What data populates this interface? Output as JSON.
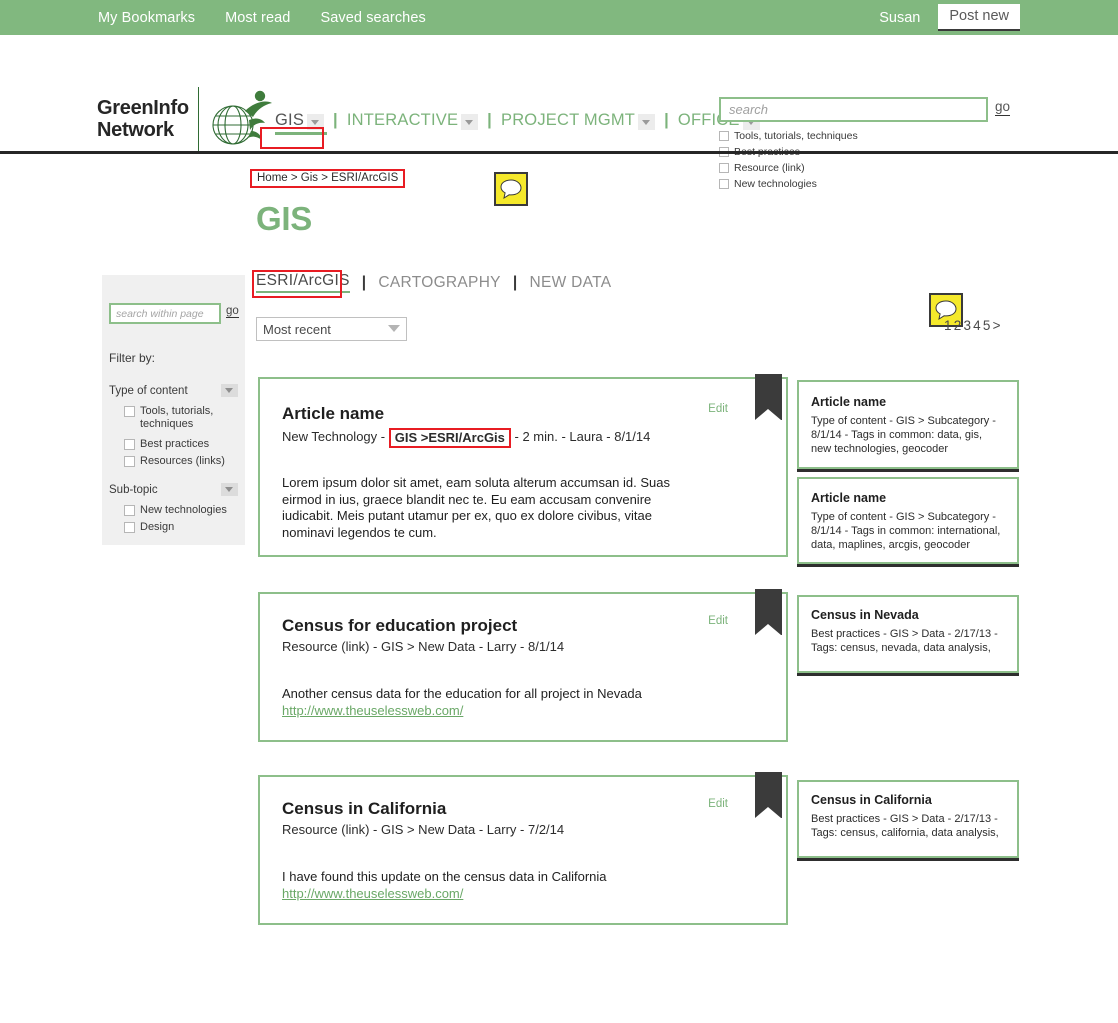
{
  "topbar": {
    "links": [
      "My Bookmarks",
      "Most read",
      "Saved searches"
    ],
    "user": "Susan",
    "post_new": "Post new",
    "bg_color": "#81b87f"
  },
  "logo": {
    "line1": "GreenInfo",
    "line2": "Network"
  },
  "nav": {
    "items": [
      {
        "label": "GIS",
        "active": true
      },
      {
        "label": "INTERACTIVE",
        "active": false
      },
      {
        "label": "PROJECT MGMT",
        "active": false
      },
      {
        "label": "OFFICE",
        "active": false
      }
    ],
    "separator": "|",
    "accent_color": "#7cb37b"
  },
  "search": {
    "placeholder": "search",
    "value": "",
    "go_label": "go",
    "filters": [
      "Tools, tutorials, techniques",
      "Best practices",
      "Resource (link)",
      "New technologies"
    ]
  },
  "breadcrumb": "Home > Gis > ESRI/ArcGIS",
  "page_title": "GIS",
  "tabs": {
    "items": [
      {
        "label": "ESRI/ArcGIS",
        "active": true
      },
      {
        "label": "CARTOGRAPHY",
        "active": false
      },
      {
        "label": "NEW DATA",
        "active": false
      }
    ],
    "separator": "|"
  },
  "sort": {
    "selected": "Most recent"
  },
  "pagination": {
    "pages": [
      "1",
      "2",
      "3",
      "4",
      "5"
    ],
    "next": ">"
  },
  "sidebar": {
    "search_placeholder": "search within page",
    "search_value": "",
    "go_label": "go",
    "filter_by_label": "Filter by:",
    "groups": [
      {
        "heading": "Type of content",
        "options": [
          "Tools, tutorials, techniques",
          "Best practices",
          "Resources (links)"
        ]
      },
      {
        "heading": "Sub-topic",
        "options": [
          "New technologies",
          "Design"
        ]
      }
    ]
  },
  "cards": [
    {
      "title": "Article name",
      "meta_pre": "New Technology - ",
      "meta_highlight": "GIS >ESRI/ArcGis",
      "meta_post": " - 2 min.  - Laura -  8/1/14",
      "body": "Lorem ipsum dolor sit amet, eam soluta alterum accumsan id. Suas eirmod in ius, graece blandit nec te. Eu eam accusam convenire iudicabit. Meis putant utamur per ex, quo ex dolore civibus, vitae nominavi legendos te cum.",
      "link": "",
      "edit_label": "Edit"
    },
    {
      "title": "Census for education project",
      "meta_pre": "Resource (link) -  GIS > New Data -  Larry - 8/1/14",
      "meta_highlight": "",
      "meta_post": "",
      "body": "Another census data for the education for all project in Nevada",
      "link": "http://www.theuselessweb.com/",
      "edit_label": "Edit"
    },
    {
      "title": "Census in California",
      "meta_pre": "Resource (link) -  GIS > New Data -  Larry - 7/2/14",
      "meta_highlight": "",
      "meta_post": "",
      "body": "I have found this update on the census data in California",
      "link": "http://www.theuselessweb.com/",
      "edit_label": "Edit"
    }
  ],
  "related": [
    {
      "title": "Article name",
      "meta": "Type of content  -  GIS > Subcategory  - 8/1/14 - Tags in common: data, gis, new technologies, geocoder"
    },
    {
      "title": "Article name",
      "meta": "Type of content  -  GIS > Subcategory  - 8/1/14 - Tags in common: international, data, maplines, arcgis, geocoder"
    },
    {
      "title": "Census in Nevada",
      "meta": "Best practices -  GIS > Data - 2/17/13 - Tags: census, nevada, data analysis,"
    },
    {
      "title": "Census in California",
      "meta": "Best practices -  GIS > Data - 2/17/13 - Tags: census, california, data analysis,"
    }
  ],
  "icons": {
    "comment_bubble": "comment-bubble-icon",
    "bookmark_ribbon": "bookmark-ribbon-icon"
  }
}
